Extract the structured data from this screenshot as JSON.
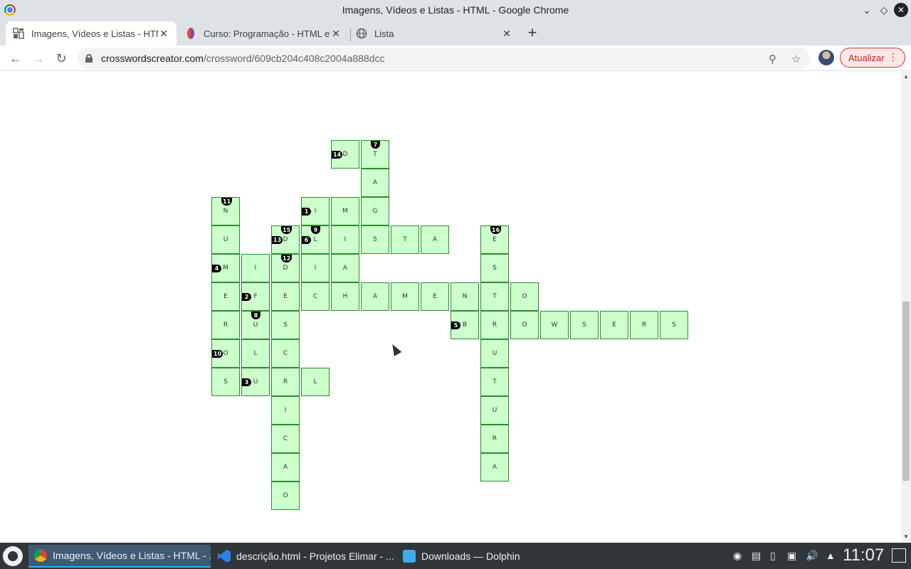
{
  "window": {
    "title": "Imagens, Vídeos e Listas - HTML - Google Chrome"
  },
  "tabs": [
    {
      "label": "Imagens, Vídeos e Listas - HTML - Google Chrome",
      "active": true
    },
    {
      "label": "Curso: Programação - HTML e CSS",
      "active": false
    },
    {
      "label": "Lista",
      "active": false
    }
  ],
  "toolbar": {
    "url_host": "crosswordscreator.com",
    "url_path": "/crossword/609cb204c408c2004a888dcc",
    "update_label": "Atualizar"
  },
  "crossword": {
    "cells": [
      {
        "c": 4,
        "r": 0,
        "l": "D",
        "n": "14",
        "p": "left"
      },
      {
        "c": 5,
        "r": 0,
        "l": "T",
        "n": "7",
        "p": "top"
      },
      {
        "c": 5,
        "r": 1,
        "l": "A"
      },
      {
        "c": 0,
        "r": 2,
        "l": "N",
        "n": "11",
        "p": "top"
      },
      {
        "c": 3,
        "r": 2,
        "l": "I",
        "n": "1",
        "p": "left"
      },
      {
        "c": 4,
        "r": 2,
        "l": "M"
      },
      {
        "c": 5,
        "r": 2,
        "l": "G"
      },
      {
        "c": 0,
        "r": 3,
        "l": "U"
      },
      {
        "c": 2,
        "r": 3,
        "l": "D",
        "n": "13",
        "p": "left",
        "n2": "15"
      },
      {
        "c": 3,
        "r": 3,
        "l": "L",
        "n": "6",
        "p": "left",
        "n2": "9"
      },
      {
        "c": 4,
        "r": 3,
        "l": "I"
      },
      {
        "c": 5,
        "r": 3,
        "l": "S"
      },
      {
        "c": 6,
        "r": 3,
        "l": "T"
      },
      {
        "c": 7,
        "r": 3,
        "l": "A"
      },
      {
        "c": 9,
        "r": 3,
        "l": "E",
        "n": "16",
        "p": "top"
      },
      {
        "c": 0,
        "r": 4,
        "l": "M",
        "n": "4",
        "p": "left"
      },
      {
        "c": 1,
        "r": 4,
        "l": "I"
      },
      {
        "c": 2,
        "r": 4,
        "l": "D",
        "n": "12",
        "p": "top"
      },
      {
        "c": 3,
        "r": 4,
        "l": "I"
      },
      {
        "c": 4,
        "r": 4,
        "l": "A"
      },
      {
        "c": 9,
        "r": 4,
        "l": "S"
      },
      {
        "c": 0,
        "r": 5,
        "l": "E"
      },
      {
        "c": 1,
        "r": 5,
        "l": "F",
        "n": "2",
        "p": "left"
      },
      {
        "c": 2,
        "r": 5,
        "l": "E"
      },
      {
        "c": 3,
        "r": 5,
        "l": "C"
      },
      {
        "c": 4,
        "r": 5,
        "l": "H"
      },
      {
        "c": 5,
        "r": 5,
        "l": "A"
      },
      {
        "c": 6,
        "r": 5,
        "l": "M"
      },
      {
        "c": 7,
        "r": 5,
        "l": "E"
      },
      {
        "c": 8,
        "r": 5,
        "l": "N"
      },
      {
        "c": 9,
        "r": 5,
        "l": "T"
      },
      {
        "c": 10,
        "r": 5,
        "l": "O"
      },
      {
        "c": 0,
        "r": 6,
        "l": "R"
      },
      {
        "c": 1,
        "r": 6,
        "l": "U",
        "n": "8",
        "p": "top"
      },
      {
        "c": 2,
        "r": 6,
        "l": "S"
      },
      {
        "c": 8,
        "r": 6,
        "l": "B",
        "n": "5",
        "p": "left"
      },
      {
        "c": 9,
        "r": 6,
        "l": "R"
      },
      {
        "c": 10,
        "r": 6,
        "l": "O"
      },
      {
        "c": 11,
        "r": 6,
        "l": "W"
      },
      {
        "c": 12,
        "r": 6,
        "l": "S"
      },
      {
        "c": 13,
        "r": 6,
        "l": "E"
      },
      {
        "c": 14,
        "r": 6,
        "l": "R"
      },
      {
        "c": 15,
        "r": 6,
        "l": "S"
      },
      {
        "c": 0,
        "r": 7,
        "l": "O",
        "n": "10",
        "p": "left"
      },
      {
        "c": 1,
        "r": 7,
        "l": "L"
      },
      {
        "c": 2,
        "r": 7,
        "l": "C"
      },
      {
        "c": 9,
        "r": 7,
        "l": "U"
      },
      {
        "c": 0,
        "r": 8,
        "l": "S"
      },
      {
        "c": 1,
        "r": 8,
        "l": "U",
        "n": "3",
        "p": "left"
      },
      {
        "c": 2,
        "r": 8,
        "l": "R"
      },
      {
        "c": 3,
        "r": 8,
        "l": "L"
      },
      {
        "c": 9,
        "r": 8,
        "l": "T"
      },
      {
        "c": 2,
        "r": 9,
        "l": "I"
      },
      {
        "c": 9,
        "r": 9,
        "l": "U"
      },
      {
        "c": 2,
        "r": 10,
        "l": "C"
      },
      {
        "c": 9,
        "r": 10,
        "l": "R"
      },
      {
        "c": 2,
        "r": 11,
        "l": "A"
      },
      {
        "c": 9,
        "r": 11,
        "l": "A"
      },
      {
        "c": 2,
        "r": 12,
        "l": "O"
      }
    ]
  },
  "taskbar": {
    "tasks": [
      {
        "label": "Imagens, Vídeos e Listas - HTML - ...",
        "active": true,
        "icon": "chrome-icon"
      },
      {
        "label": "descrição.html - Projetos Elimar - ...",
        "active": false,
        "icon": "vscode-icon"
      },
      {
        "label": "Downloads — Dolphin",
        "active": false,
        "icon": "folder-icon"
      }
    ],
    "clock": "11:07"
  }
}
